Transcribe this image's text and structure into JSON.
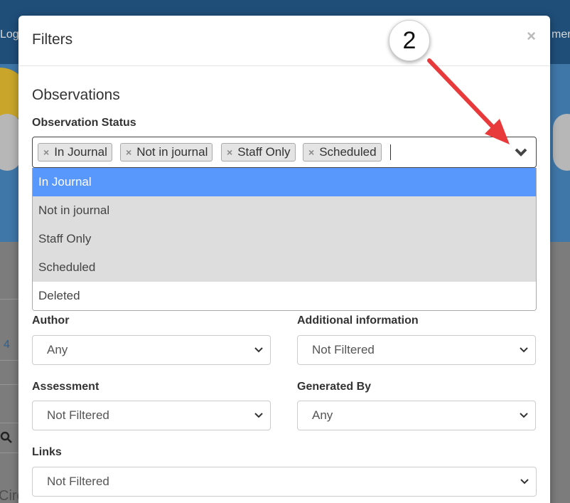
{
  "background": {
    "topbar_left_text": "Log",
    "topbar_right_text": "men",
    "side_number": "4",
    "bottom_left_text": "Circ"
  },
  "modal": {
    "title": "Filters",
    "close_symbol": "×"
  },
  "observations": {
    "section_title": "Observations",
    "status_label": "Observation Status",
    "selected_tags": [
      "In Journal",
      "Not in journal",
      "Staff Only",
      "Scheduled"
    ],
    "options": [
      "In Journal",
      "Not in journal",
      "Staff Only",
      "Scheduled",
      "Deleted"
    ],
    "highlighted_option": "In Journal"
  },
  "filters": {
    "author_label": "Author",
    "author_value": "Any",
    "additional_label": "Additional information",
    "additional_value": "Not Filtered",
    "assessment_label": "Assessment",
    "assessment_value": "Not Filtered",
    "generated_label": "Generated By",
    "generated_value": "Any",
    "links_label": "Links",
    "links_value": "Not Filtered"
  },
  "annotation": {
    "step_number": "2",
    "arrow_color": "#e8393b"
  }
}
